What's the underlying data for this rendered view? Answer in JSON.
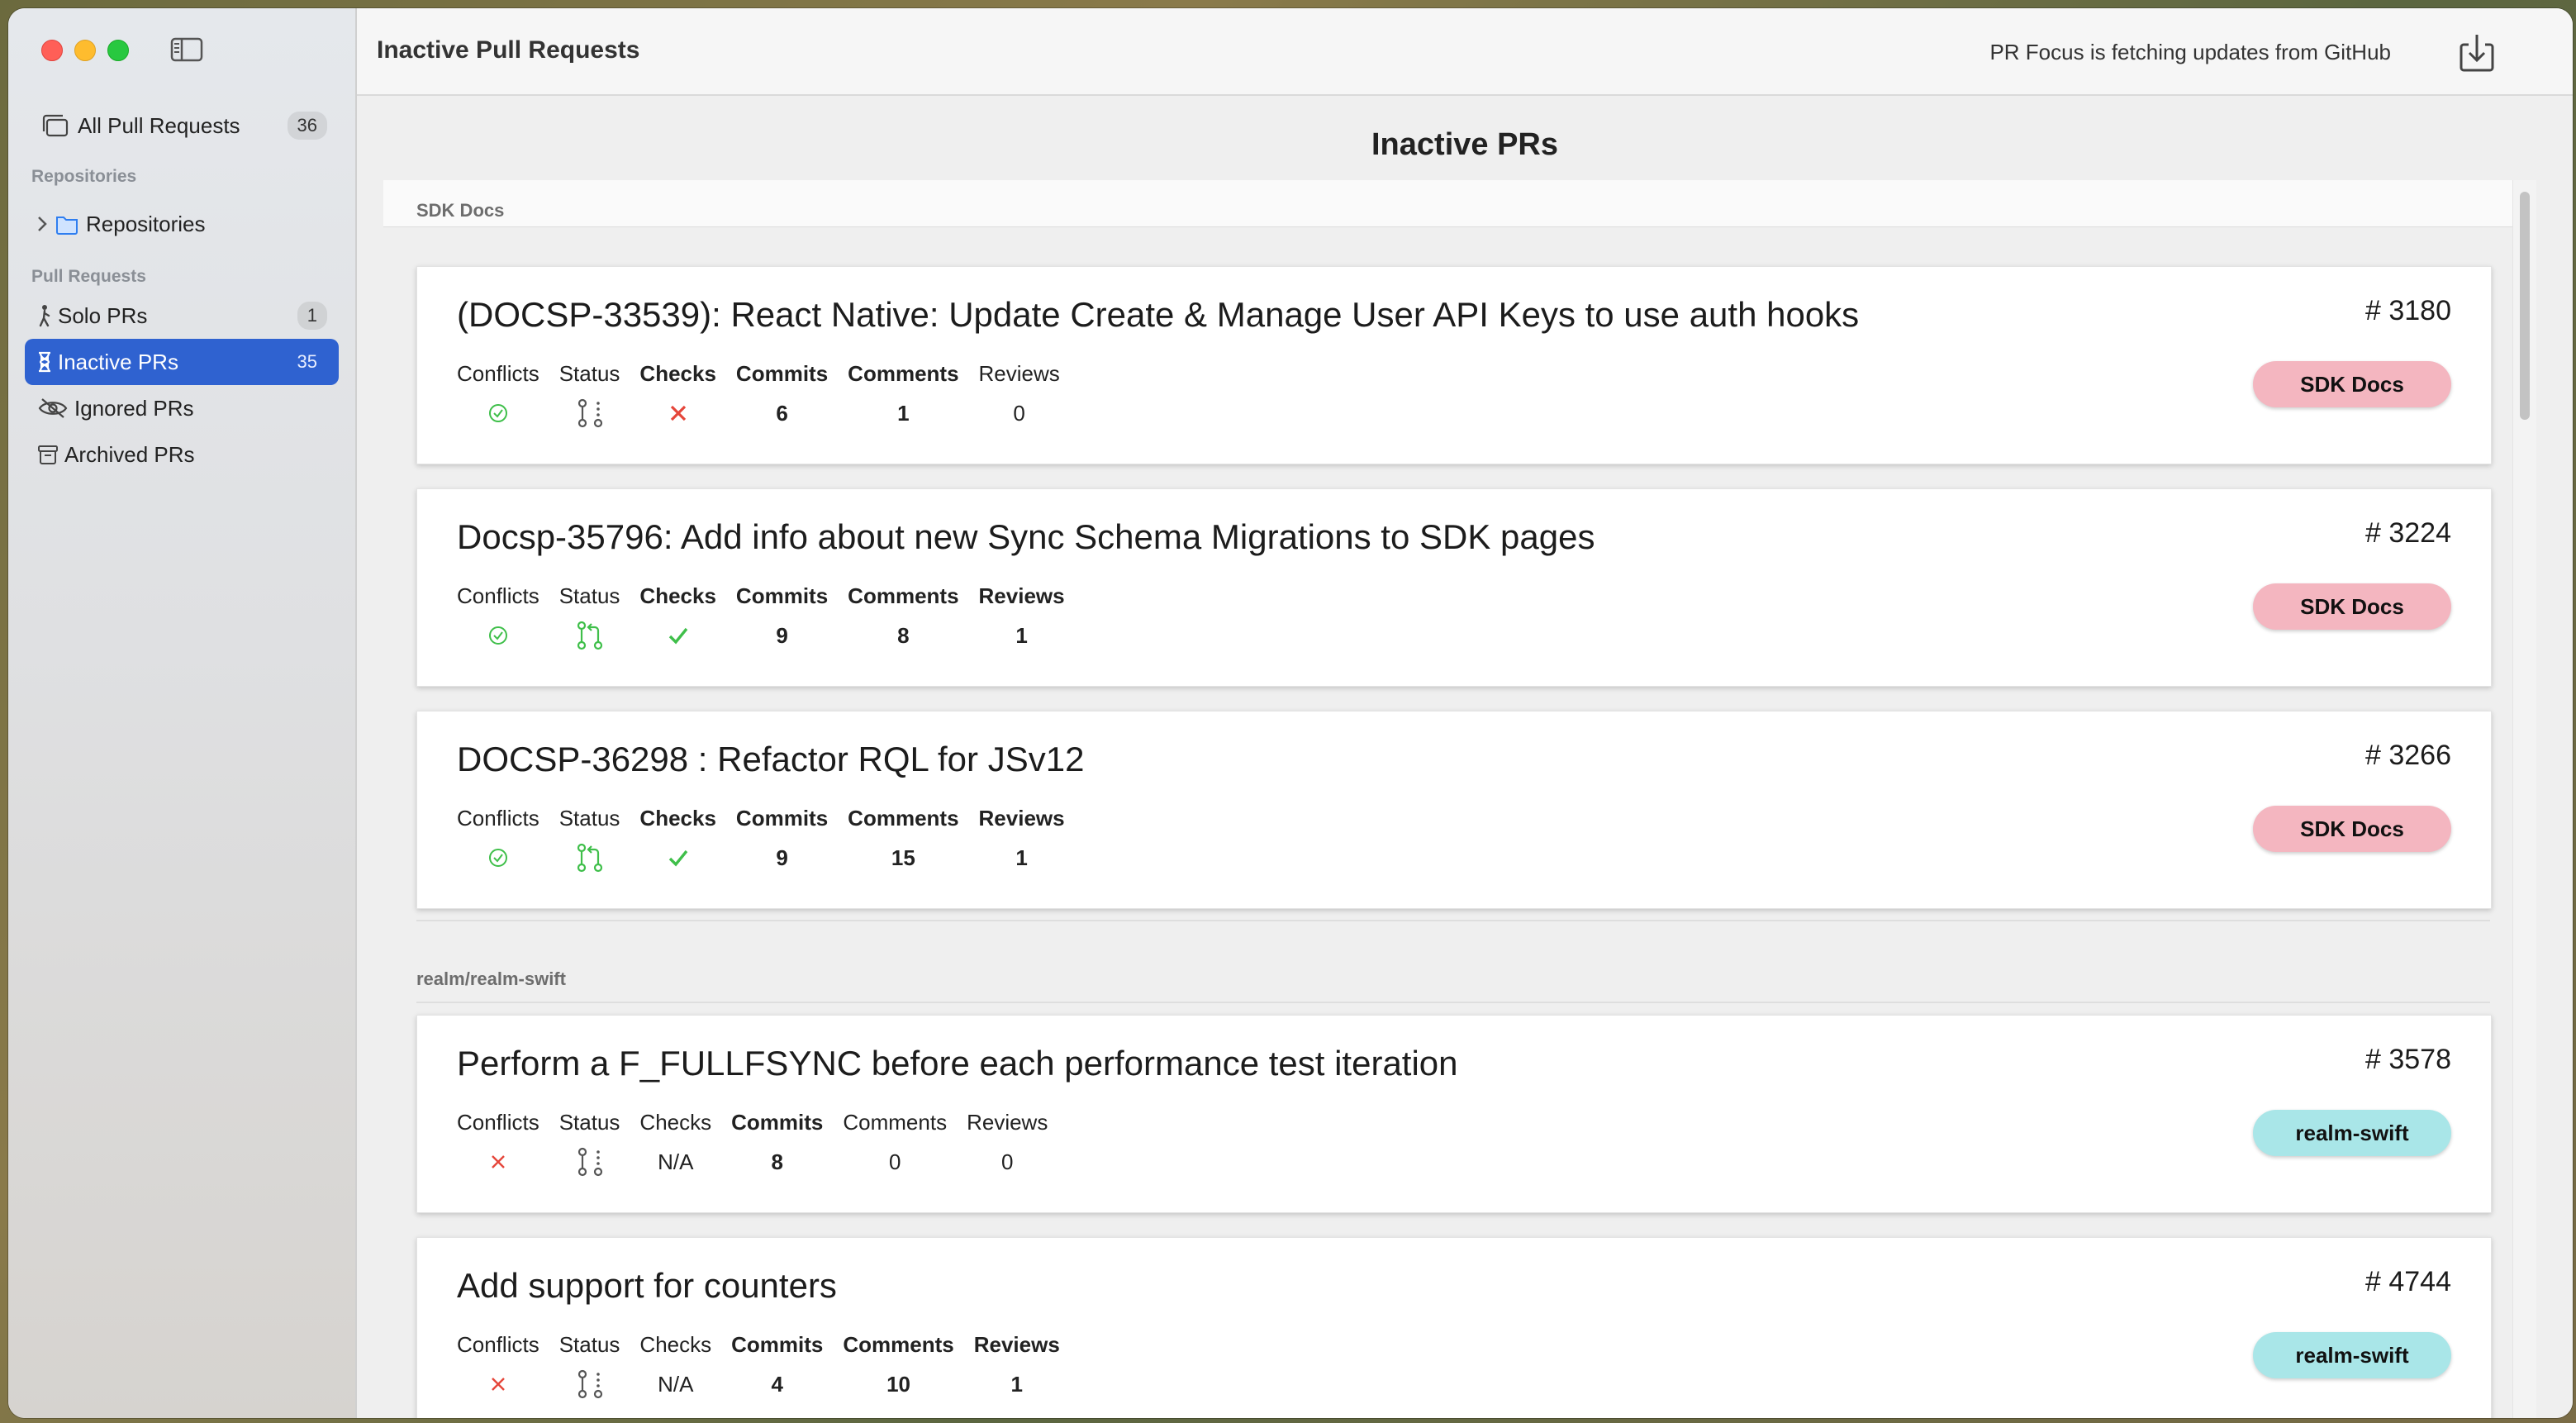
{
  "window": {
    "title": "Inactive Pull Requests",
    "status": "PR Focus is fetching updates from GitHub"
  },
  "sidebar": {
    "all": {
      "label": "All Pull Requests",
      "count": "36"
    },
    "repos_section": "Repositories",
    "repos_item": "Repositories",
    "prs_section": "Pull Requests",
    "items": [
      {
        "label": "Solo PRs",
        "count": "1"
      },
      {
        "label": "Inactive PRs",
        "count": "35"
      },
      {
        "label": "Ignored PRs",
        "count": ""
      },
      {
        "label": "Archived PRs",
        "count": ""
      }
    ]
  },
  "main": {
    "heading": "Inactive PRs",
    "metric_labels": {
      "conflicts": "Conflicts",
      "status": "Status",
      "checks": "Checks",
      "commits": "Commits",
      "comments": "Comments",
      "reviews": "Reviews"
    },
    "groups": [
      {
        "name": "SDK Docs",
        "pill_color": "#f4b6c0",
        "prs": [
          {
            "title": "(DOCSP-33539): React Native: Update Create & Manage User API Keys to use auth hooks",
            "number": "# 3180",
            "repo": "SDK Docs",
            "conflicts": "ok",
            "status": "draft",
            "checks": "fail",
            "commits": "6",
            "comments": "1",
            "reviews": "0"
          },
          {
            "title": "Docsp-35796: Add info about new Sync Schema Migrations to SDK pages",
            "number": "# 3224",
            "repo": "SDK Docs",
            "conflicts": "ok",
            "status": "open",
            "checks": "pass",
            "commits": "9",
            "comments": "8",
            "reviews": "1"
          },
          {
            "title": "DOCSP-36298 : Refactor RQL for JSv12",
            "number": "# 3266",
            "repo": "SDK Docs",
            "conflicts": "ok",
            "status": "open",
            "checks": "pass",
            "commits": "9",
            "comments": "15",
            "reviews": "1"
          }
        ]
      },
      {
        "name": "realm/realm-swift",
        "pill_color": "#a9e6e8",
        "prs": [
          {
            "title": "Perform a F_FULLFSYNC before each performance test iteration",
            "number": "# 3578",
            "repo": "realm-swift",
            "conflicts": "conflict",
            "status": "draft",
            "checks": "N/A",
            "commits": "8",
            "comments": "0",
            "reviews": "0"
          },
          {
            "title": "Add support for counters",
            "number": "# 4744",
            "repo": "realm-swift",
            "conflicts": "conflict",
            "status": "draft",
            "checks": "N/A",
            "commits": "4",
            "comments": "10",
            "reviews": "1"
          }
        ]
      }
    ]
  },
  "colors": {
    "accent": "#2f62d0",
    "ok_green": "#3fbf4a",
    "fail_red": "#e5463a"
  }
}
